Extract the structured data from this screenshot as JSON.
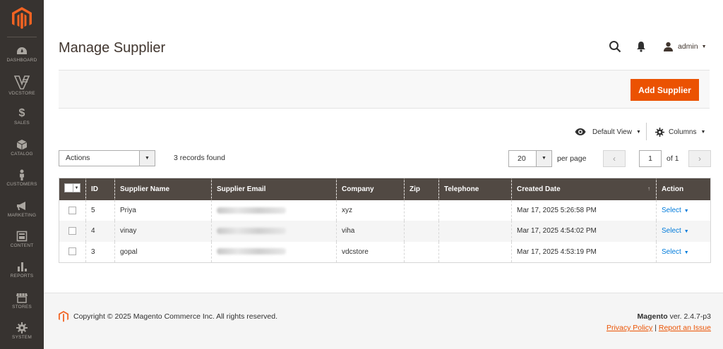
{
  "sidebar": {
    "items": [
      {
        "label": "DASHBOARD",
        "icon": "dashboard-icon"
      },
      {
        "label": "VDCSTORE",
        "icon": "vdcstore-icon"
      },
      {
        "label": "SALES",
        "icon": "dollar-icon"
      },
      {
        "label": "CATALOG",
        "icon": "catalog-box-icon"
      },
      {
        "label": "CUSTOMERS",
        "icon": "person-icon"
      },
      {
        "label": "MARKETING",
        "icon": "megaphone-icon"
      },
      {
        "label": "CONTENT",
        "icon": "content-icon"
      },
      {
        "label": "REPORTS",
        "icon": "bar-chart-icon"
      },
      {
        "label": "STORES",
        "icon": "store-icon"
      },
      {
        "label": "SYSTEM",
        "icon": "gear-icon"
      }
    ]
  },
  "header": {
    "title": "Manage Supplier",
    "user": "admin"
  },
  "toolbar": {
    "add_label": "Add Supplier",
    "view_label": "Default View",
    "columns_label": "Columns"
  },
  "grid_controls": {
    "actions_label": "Actions",
    "records_found": "3 records found",
    "per_page_value": "20",
    "per_page_label": "per page",
    "page_value": "1",
    "page_of": "of 1"
  },
  "table": {
    "headers": [
      "ID",
      "Supplier Name",
      "Supplier Email",
      "Company",
      "Zip",
      "Telephone",
      "Created Date",
      "Action"
    ],
    "rows": [
      {
        "id": "5",
        "name": "Priya",
        "company": "xyz",
        "zip": "",
        "telephone": "",
        "created": "Mar 17, 2025 5:26:58 PM",
        "action": "Select"
      },
      {
        "id": "4",
        "name": "vinay",
        "company": "viha",
        "zip": "",
        "telephone": "",
        "created": "Mar 17, 2025 4:54:02 PM",
        "action": "Select"
      },
      {
        "id": "3",
        "name": "gopal",
        "company": "vdcstore",
        "zip": "",
        "telephone": "",
        "created": "Mar 17, 2025 4:53:19 PM",
        "action": "Select"
      }
    ]
  },
  "footer": {
    "copyright": "Copyright © 2025 Magento Commerce Inc. All rights reserved.",
    "brand": "Magento",
    "version": " ver. 2.4.7-p3",
    "privacy": "Privacy Policy",
    "separator": " | ",
    "report": "Report an Issue"
  },
  "colors": {
    "accent": "#eb5202",
    "sidebar_bg": "#373330",
    "table_header_bg": "#514943",
    "link": "#007bdb"
  }
}
